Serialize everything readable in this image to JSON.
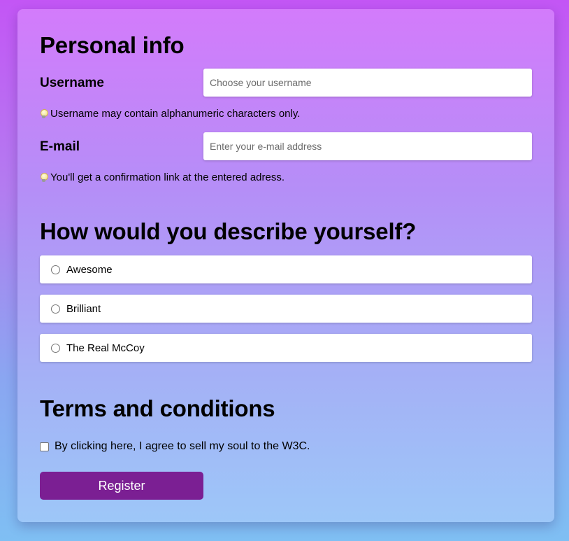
{
  "personal_info": {
    "title": "Personal info",
    "username": {
      "label": "Username",
      "value": "",
      "placeholder": "Choose your username",
      "hint": "Username may contain alphanumeric characters only."
    },
    "email": {
      "label": "E-mail",
      "value": "",
      "placeholder": "Enter your e-mail address",
      "hint": "You'll get a confirmation link at the entered adress."
    },
    "hint_icon": "lightbulb-icon"
  },
  "describe": {
    "title": "How would you describe yourself?",
    "options": [
      {
        "label": "Awesome",
        "selected": false
      },
      {
        "label": "Brilliant",
        "selected": false
      },
      {
        "label": "The Real McCoy",
        "selected": false
      }
    ]
  },
  "terms": {
    "title": "Terms and conditions",
    "checkbox_label": "By clicking here, I agree to sell my soul to the W3C.",
    "checked": false
  },
  "actions": {
    "register_label": "Register"
  },
  "colors": {
    "button": "#7b1f93",
    "background_top": "#c356f5",
    "background_bottom": "#7fbff3"
  }
}
